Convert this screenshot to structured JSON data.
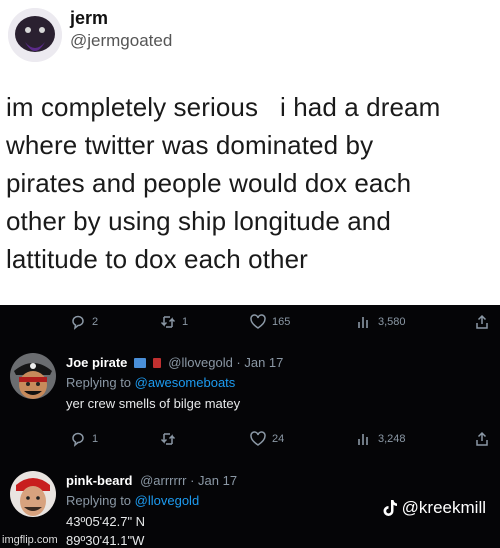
{
  "top_tweet": {
    "name": "jerm",
    "handle": "@jermgoated",
    "lines": [
      "im completely serious   i had a dream",
      "where twitter was dominated by",
      "pirates and people would dox each",
      "other by using ship longitude and",
      "lattitude to dox each other"
    ]
  },
  "stats_row_1": {
    "replies": "2",
    "retweets": "1",
    "likes": "165",
    "views": "3,580"
  },
  "reply_1": {
    "name": "Joe pirate",
    "handle": "@llovegold · Jan 17",
    "replying_prefix": "Replying to ",
    "replying_to": "@awesomeboats",
    "text": "yer crew smells of bilge matey"
  },
  "stats_row_2": {
    "replies": "1",
    "retweets": "",
    "likes": "24",
    "views": "3,248"
  },
  "reply_2": {
    "name": "pink-beard",
    "handle": "@arrrrrr · Jan 17",
    "replying_prefix": "Replying to ",
    "replying_to": "@llovegold",
    "line1": "43º05'42.7\" N",
    "line2": "89º30'41.1\"W"
  },
  "watermark": "@kreekmill",
  "credit": "imgflip.com",
  "icons": [
    "reply-icon",
    "retweet-icon",
    "heart-icon",
    "views-icon",
    "share-icon",
    "tiktok-icon"
  ]
}
